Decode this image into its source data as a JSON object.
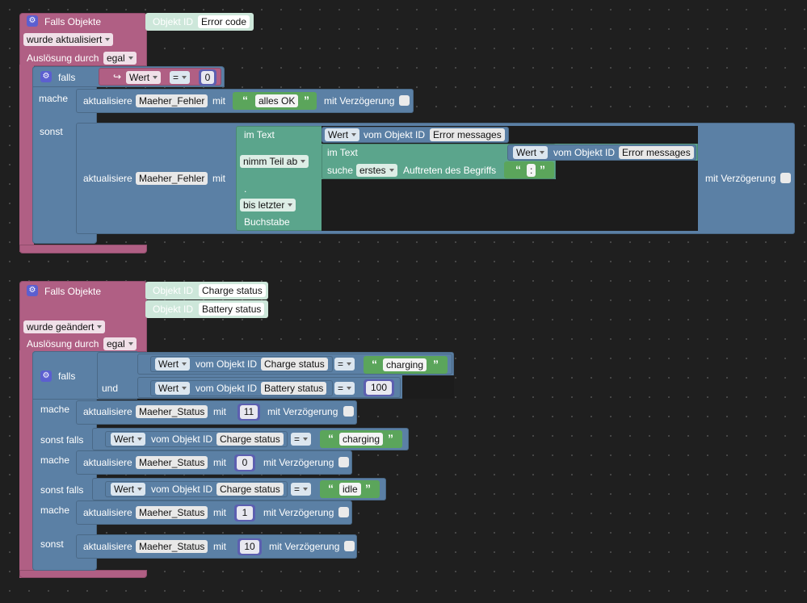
{
  "common": {
    "falls_objekte": "Falls Objekte",
    "objekt_id": "Objekt ID",
    "ausloesung": "Auslösung durch",
    "egal": "egal",
    "falls": "falls",
    "mache": "mache",
    "sonst": "sonst",
    "sonst_falls": "sonst falls",
    "und": "und",
    "aktualisiere": "aktualisiere",
    "mit": "mit",
    "mit_verzoegerung": "mit Verzögerung",
    "wert": "Wert",
    "vom_objekt_id": "vom Objekt ID",
    "eq": "=",
    "quote_open": "“",
    "quote_close": "”",
    "gear_glyph": "⚙"
  },
  "event1": {
    "object": "Error code",
    "trigger": "wurde aktualisiert",
    "cond_value": "0",
    "then_target": "Maeher_Fehler",
    "then_text": "alles OK",
    "else_target": "Maeher_Fehler",
    "substr": {
      "im_text": "im Text",
      "nimm_teil_ab": "nimm Teil ab",
      "dot": ".",
      "bis_letzter": "bis letzter",
      "buchstabe": "Buchstabe",
      "source_object": "Error messages",
      "inner_im_text": "im Text",
      "inner_object": "Error messages",
      "suche": "suche",
      "erstes": "erstes",
      "auftreten": "Auftreten des Begriffs",
      "search_term": ":"
    }
  },
  "event2": {
    "objects": [
      "Charge status",
      "Battery status"
    ],
    "trigger": "wurde geändert",
    "cond1": {
      "object": "Charge status",
      "text": "charging"
    },
    "cond2": {
      "object": "Battery status",
      "value": "100"
    },
    "then1": {
      "target": "Maeher_Status",
      "value": "11"
    },
    "elif1": {
      "object": "Charge status",
      "text": "charging"
    },
    "then2": {
      "target": "Maeher_Status",
      "value": "0"
    },
    "elif2": {
      "object": "Charge status",
      "text": "idle"
    },
    "then3": {
      "target": "Maeher_Status",
      "value": "1"
    },
    "else": {
      "target": "Maeher_Status",
      "value": "10"
    }
  }
}
